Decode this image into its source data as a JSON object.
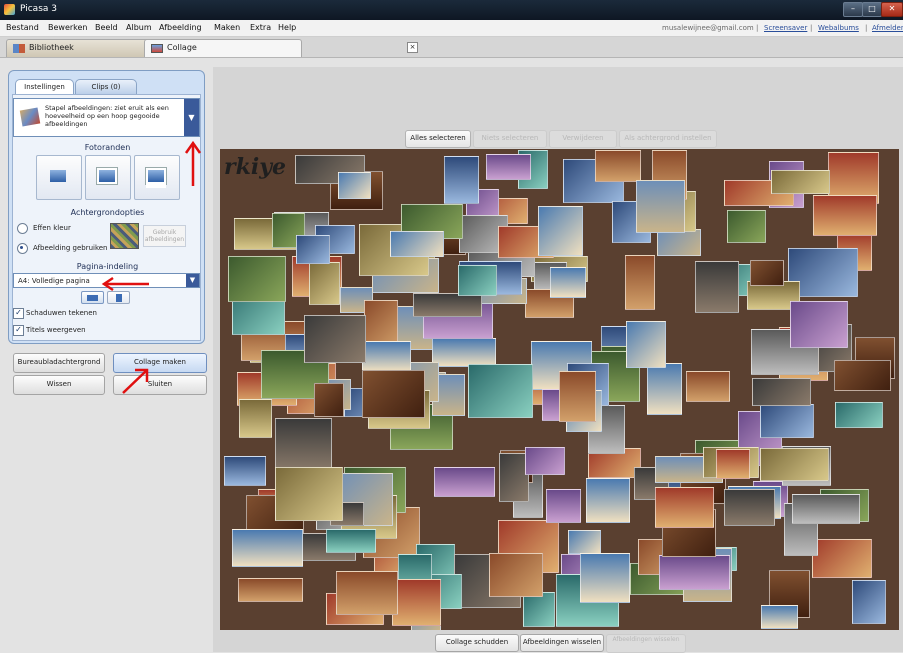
{
  "window": {
    "title": "Picasa 3"
  },
  "menu": {
    "items": [
      "Bestand",
      "Bewerken",
      "Beeld",
      "Album",
      "Afbeelding",
      "Maken",
      "Extra",
      "Help"
    ],
    "account_email": "musalewijnee@gmail.com",
    "links": [
      "Screensaver",
      "Webalbums",
      "Afmelden"
    ]
  },
  "tabs": {
    "library": "Bibliotheek",
    "collage": "Collage"
  },
  "panel": {
    "tabs": {
      "settings": "Instellingen",
      "clips": "Clips (0)"
    },
    "style_text": "Stapel afbeeldingen: ziet eruit als een hoeveelheid op een hoop gegooide afbeeldingen",
    "photo_borders_title": "Fotoranden",
    "background_title": "Achtergrondopties",
    "bg_solid": "Effen kleur",
    "bg_image": "Afbeelding gebruiken",
    "choose_image": "Gebruik afbeeldingen",
    "page_layout_title": "Pagina-indeling",
    "page_layout_value": "A4: Volledige pagina",
    "draw_shadows": "Schaduwen tekenen",
    "show_titles": "Titels weergeven",
    "btn_desktop_bg": "Bureaubladachtergrond",
    "btn_make_collage": "Collage maken",
    "btn_clear": "Wissen",
    "btn_close": "Sluiten"
  },
  "canvas": {
    "top_buttons": {
      "select_all": "Alles selecteren",
      "clear_selection": "Niets selecteren",
      "remove": "Verwijderen",
      "recenter": "Als achtergrond instellen"
    },
    "title_text": "rkiye",
    "bottom_buttons": {
      "shuffle": "Collage schudden",
      "swap": "Afbeeldingen wisselen",
      "swap_photos": "Afbeeldingen wisselen"
    }
  },
  "colors": {
    "accent": "#3a5a9a",
    "annotation": "#e01010",
    "panel_bg": "#cfe0f5"
  }
}
